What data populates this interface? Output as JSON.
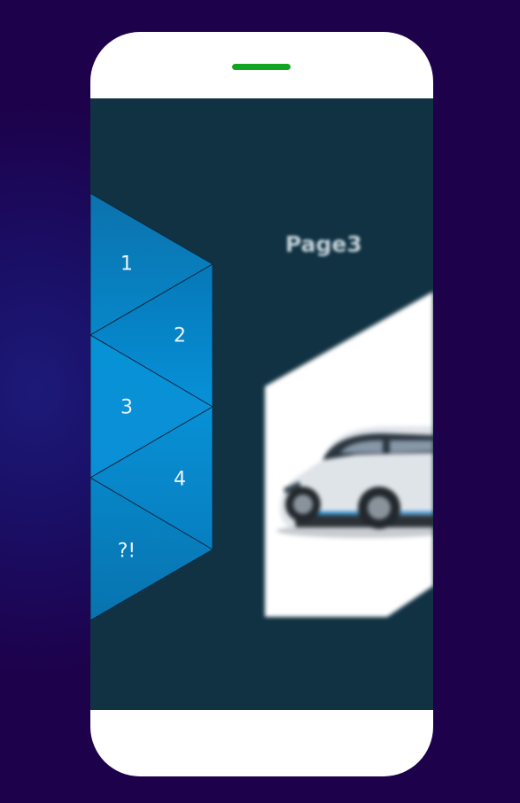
{
  "device": {
    "indicator_color": "#12a51f"
  },
  "screen": {
    "background": "#113243",
    "title": "Page3"
  },
  "menu": {
    "items": [
      {
        "label": "1"
      },
      {
        "label": "2"
      },
      {
        "label": "3"
      },
      {
        "label": "4"
      },
      {
        "label": "?!"
      }
    ]
  },
  "card": {
    "image": "car-image",
    "car_color": "#d9dfe5",
    "accent_color": "#1f8bd4"
  }
}
